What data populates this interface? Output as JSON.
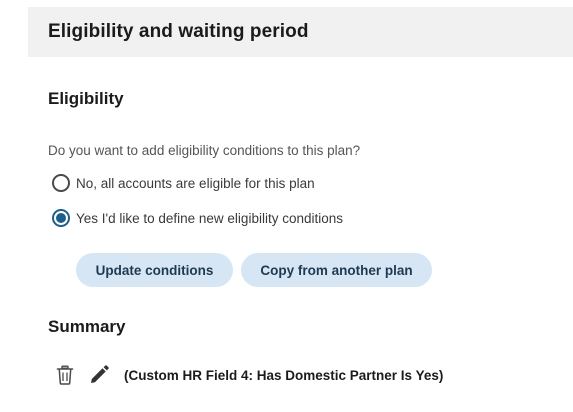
{
  "header": {
    "title": "Eligibility and waiting period"
  },
  "eligibility": {
    "title": "Eligibility",
    "question": "Do you want to add eligibility conditions to this plan?",
    "options": [
      {
        "label": "No, all accounts are eligible for this plan",
        "selected": false
      },
      {
        "label": "Yes I'd like to define new eligibility conditions",
        "selected": true
      }
    ],
    "buttons": {
      "update_label": "Update conditions",
      "copy_label": "Copy from another plan"
    }
  },
  "summary": {
    "title": "Summary",
    "conditions": [
      {
        "text": "(Custom HR Field 4: Has Domestic Partner Is Yes)",
        "icons": [
          "trash-icon",
          "pencil-icon"
        ]
      }
    ]
  },
  "colors": {
    "accent": "#1d5f8a",
    "button_bg": "#d6e6f4",
    "header_bg": "#f1f1f1"
  }
}
